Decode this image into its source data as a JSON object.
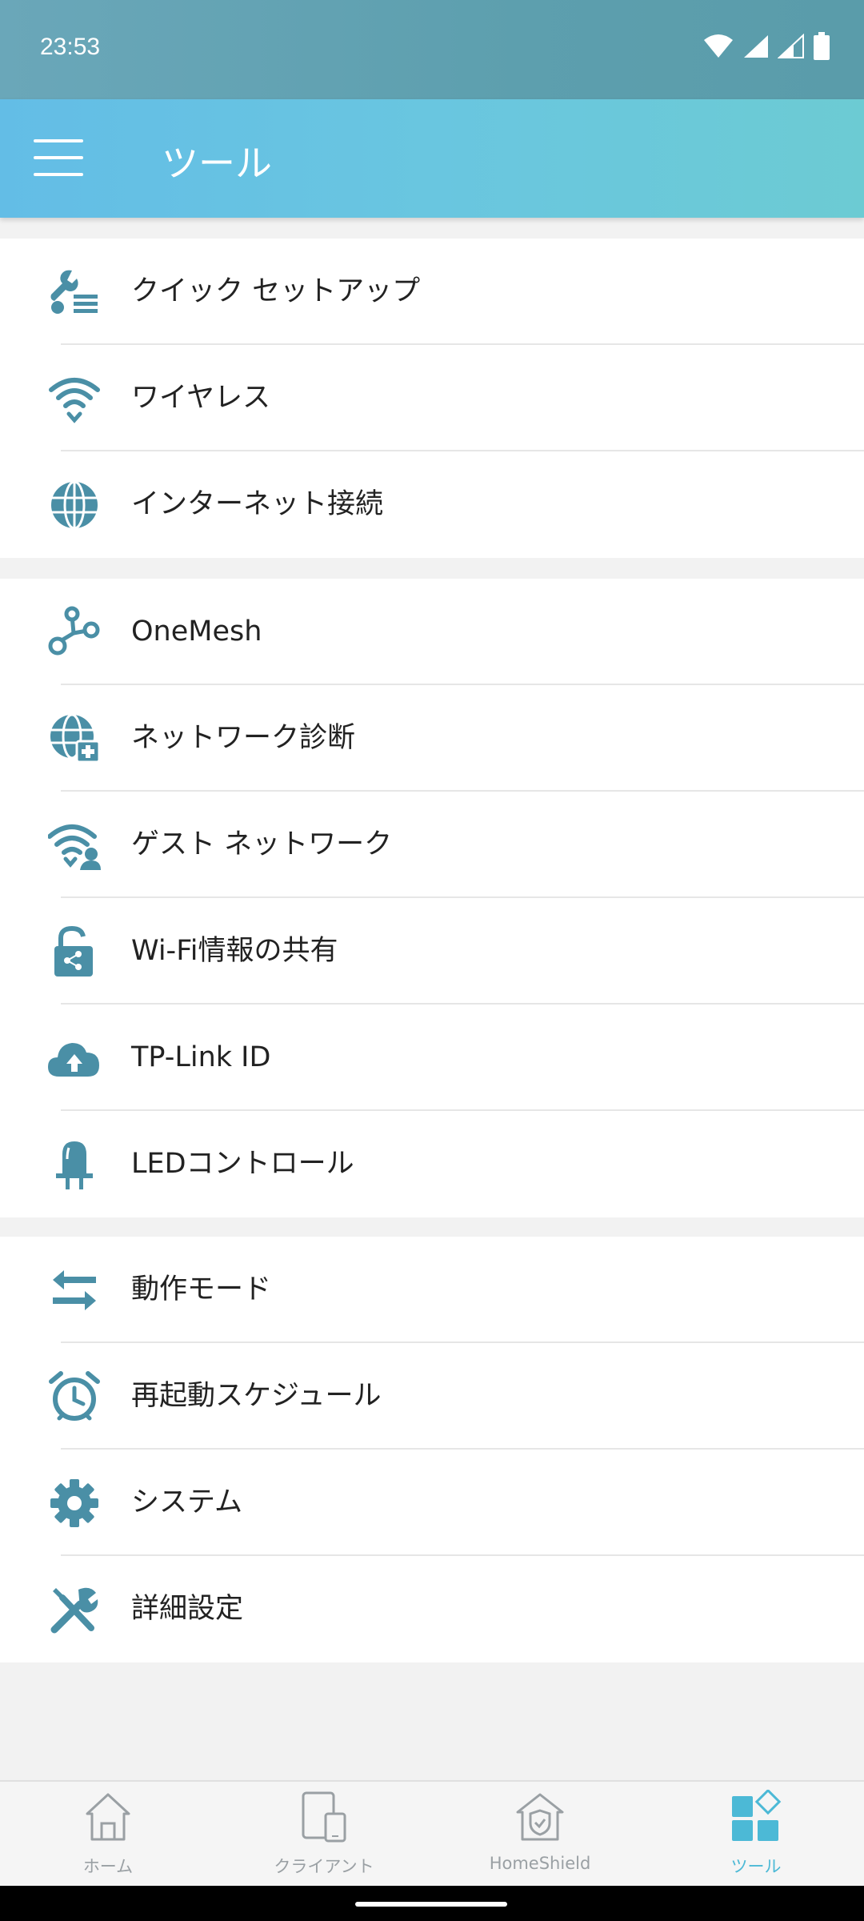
{
  "status_bar": {
    "time": "23:53"
  },
  "header": {
    "title": "ツール"
  },
  "groups": [
    {
      "items": [
        {
          "label": "クイック セットアップ",
          "icon": "wrench-list-icon"
        },
        {
          "label": "ワイヤレス",
          "icon": "wifi-icon"
        },
        {
          "label": "インターネット接続",
          "icon": "globe-icon"
        }
      ]
    },
    {
      "items": [
        {
          "label": "OneMesh",
          "icon": "mesh-nodes-icon"
        },
        {
          "label": "ネットワーク診断",
          "icon": "globe-medical-icon"
        },
        {
          "label": "ゲスト ネットワーク",
          "icon": "wifi-guest-icon"
        },
        {
          "label": "Wi-Fi情報の共有",
          "icon": "unlock-share-icon"
        },
        {
          "label": "TP-Link ID",
          "icon": "cloud-upload-icon"
        },
        {
          "label": "LEDコントロール",
          "icon": "led-icon"
        }
      ]
    },
    {
      "items": [
        {
          "label": "動作モード",
          "icon": "swap-arrows-icon"
        },
        {
          "label": "再起動スケジュール",
          "icon": "alarm-clock-icon"
        },
        {
          "label": "システム",
          "icon": "gear-icon"
        },
        {
          "label": "詳細設定",
          "icon": "tools-icon"
        }
      ]
    }
  ],
  "bottom_nav": [
    {
      "label": "ホーム",
      "icon": "home-icon",
      "active": false
    },
    {
      "label": "クライアント",
      "icon": "devices-icon",
      "active": false
    },
    {
      "label": "HomeShield",
      "icon": "shield-house-icon",
      "active": false
    },
    {
      "label": "ツール",
      "icon": "tools-grid-icon",
      "active": true
    }
  ],
  "colors": {
    "icon": "#4a8fa6",
    "accent": "#4cb9d6",
    "header_start": "#63bde6",
    "header_end": "#6ccbd3"
  }
}
